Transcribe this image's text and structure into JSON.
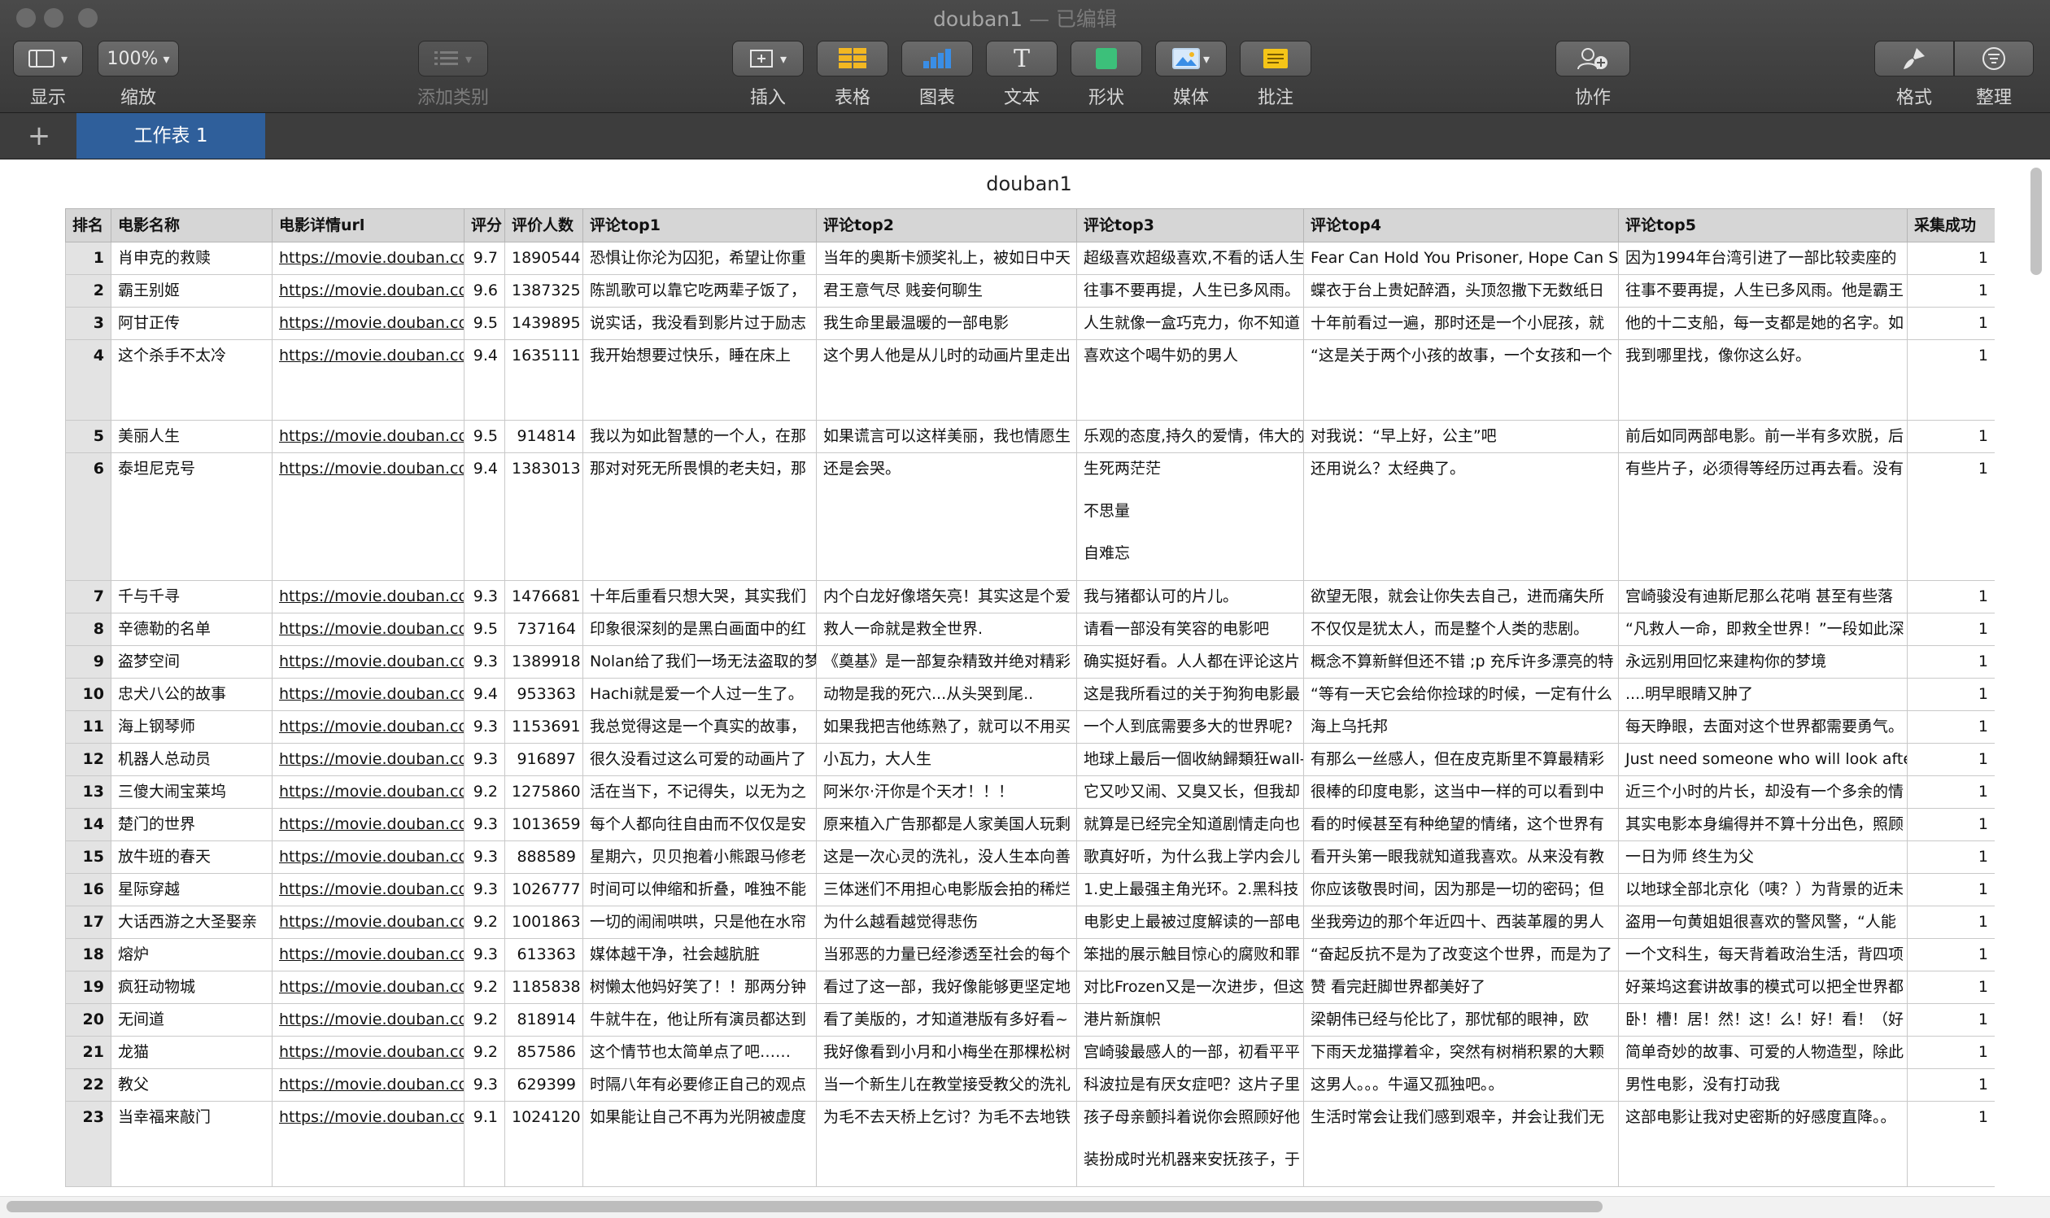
{
  "window": {
    "title": "douban1",
    "title_suffix": "— 已编辑"
  },
  "toolbar": {
    "view_label": "显示",
    "zoom_value": "100%",
    "zoom_label": "缩放",
    "category_label": "添加类别",
    "insert_label": "插入",
    "table_label": "表格",
    "chart_label": "图表",
    "text_label": "文本",
    "text_glyph": "T",
    "shape_label": "形状",
    "media_label": "媒体",
    "comment_label": "批注",
    "collab_label": "协作",
    "format_label": "格式",
    "organize_label": "整理",
    "colors": {
      "table": "#f2b722",
      "chart": "#3a8ee6",
      "shape": "#3cc07a",
      "comment": "#f5c518"
    }
  },
  "sheet_tabs": {
    "add": "+",
    "active": "工作表 1"
  },
  "document": {
    "title": "douban1"
  },
  "table": {
    "headers": [
      "排名",
      "电影名称",
      "电影详情url",
      "评分",
      "评价人数",
      "评论top1",
      "评论top2",
      "评论top3",
      "评论top4",
      "评论top5",
      "采集成功"
    ],
    "rows": [
      {
        "rank": "1",
        "name": "肖申克的救赎",
        "url": "https://movie.douban.com",
        "score": "9.7",
        "count": "1890544",
        "c1": "恐惧让你沦为囚犯，希望让你重",
        "c2": "当年的奥斯卡颁奖礼上，被如日中天",
        "c3": "超级喜欢超级喜欢,不看的话人生",
        "c4": "Fear Can Hold You Prisoner, Hope Can Set",
        "c5": "因为1994年台湾引进了一部比较卖座的",
        "ok": "1"
      },
      {
        "rank": "2",
        "name": "霸王别姬",
        "url": "https://movie.douban.com",
        "score": "9.6",
        "count": "1387325",
        "c1": "陈凯歌可以靠它吃两辈子饭了，",
        "c2": "君王意气尽 贱妾何聊生",
        "c3": "往事不要再提，人生已多风雨。",
        "c4": "蝶衣于台上贵妃醉酒，头顶忽撒下无数纸日",
        "c5": "往事不要再提，人生已多风雨。他是霸王",
        "ok": "1"
      },
      {
        "rank": "3",
        "name": "阿甘正传",
        "url": "https://movie.douban.com",
        "score": "9.5",
        "count": "1439895",
        "c1": "说实话，我没看到影片过于励志",
        "c2": "我生命里最温暖的一部电影",
        "c3": "人生就像一盒巧克力，你不知道",
        "c4": "十年前看过一遍，那时还是一个小屁孩，就",
        "c5": "他的十二支船，每一支都是她的名字。如",
        "ok": "1"
      },
      {
        "rank": "4",
        "name": "这个杀手不太冷",
        "url": "https://movie.douban.com",
        "score": "9.4",
        "count": "1635111",
        "c1": "我开始想要过快乐，睡在床上",
        "c2": "这个男人他是从儿时的动画片里走出",
        "c3": "喜欢这个喝牛奶的男人",
        "c4": "“这是关于两个小孩的故事，一个女孩和一个",
        "c5": "我到哪里找，像你这么好。",
        "ok": "1",
        "tall": 1
      },
      {
        "rank": "5",
        "name": "美丽人生",
        "url": "https://movie.douban.com",
        "score": "9.5",
        "count": "914814",
        "c1": "我以为如此智慧的一个人，在那",
        "c2": "如果谎言可以这样美丽，我也情愿生",
        "c3": "乐观的态度,持久的爱情，伟大的",
        "c4": "对我说：“早上好，公主”吧",
        "c5": "前后如同两部电影。前一半有多欢脱，后",
        "ok": "1"
      },
      {
        "rank": "6",
        "name": "泰坦尼克号",
        "url": "https://movie.douban.com",
        "score": "9.4",
        "count": "1383013",
        "c1": "那对对死无所畏惧的老夫妇，那",
        "c2": "还是会哭。",
        "c3": [
          "生死两茫茫",
          "不思量",
          "自难忘"
        ],
        "c4": "还用说么？太经典了。",
        "c5": "有些片子，必须得等经历过再去看。没有",
        "ok": "1",
        "tall": 2
      },
      {
        "rank": "7",
        "name": "千与千寻",
        "url": "https://movie.douban.com",
        "score": "9.3",
        "count": "1476681",
        "c1": "十年后重看只想大哭，其实我们",
        "c2": "内个白龙好像塔矢亮！其实这是个爱",
        "c3": "我与猪都认可的片儿。",
        "c4": "欲望无限，就会让你失去自己，进而痛失所",
        "c5": "宫崎骏没有迪斯尼那么花哨 甚至有些落",
        "ok": "1"
      },
      {
        "rank": "8",
        "name": "辛德勒的名单",
        "url": "https://movie.douban.com",
        "score": "9.5",
        "count": "737164",
        "c1": "印象很深刻的是黑白画面中的红",
        "c2": "救人一命就是救全世界.",
        "c3": "请看一部没有笑容的电影吧",
        "c4": "不仅仅是犹太人，而是整个人类的悲剧。",
        "c5": "“凡救人一命，即救全世界！”一段如此深",
        "ok": "1"
      },
      {
        "rank": "9",
        "name": "盗梦空间",
        "url": "https://movie.douban.com",
        "score": "9.3",
        "count": "1389918",
        "c1": "Nolan给了我们一场无法盗取的梦",
        "c2": "《奠基》是一部复杂精致并绝对精彩",
        "c3": "确实挺好看。人人都在评论这片",
        "c4": "概念不算新鲜但还不错 ;p 充斥许多漂亮的特",
        "c5": "永远别用回忆来建构你的梦境",
        "ok": "1"
      },
      {
        "rank": "10",
        "name": "忠犬八公的故事",
        "url": "https://movie.douban.com",
        "score": "9.4",
        "count": "953363",
        "c1": "Hachi就是爱一个人过一生了。",
        "c2": "动物是我的死穴...从头哭到尾..",
        "c3": "这是我所看过的关于狗狗电影最",
        "c4": "“等有一天它会给你捡球的时候，一定有什么",
        "c5": "....明早眼睛又肿了",
        "ok": "1"
      },
      {
        "rank": "11",
        "name": "海上钢琴师",
        "url": "https://movie.douban.com",
        "score": "9.3",
        "count": "1153691",
        "c1": "我总觉得这是一个真实的故事，",
        "c2": "如果我把吉他练熟了，就可以不用买",
        "c3": "一个人到底需要多大的世界呢?",
        "c4": "海上乌托邦",
        "c5": "每天睁眼，去面对这个世界都需要勇气。",
        "ok": "1"
      },
      {
        "rank": "12",
        "name": "机器人总动员",
        "url": "https://movie.douban.com",
        "score": "9.3",
        "count": "916897",
        "c1": "很久没看过这么可爱的动画片了",
        "c2": "小瓦力，大人生",
        "c3": "地球上最后一個收納歸類狂wall-e",
        "c4": "有那么一丝感人，但在皮克斯里不算最精彩",
        "c5": "Just need someone who will look after",
        "ok": "1"
      },
      {
        "rank": "13",
        "name": "三傻大闹宝莱坞",
        "url": "https://movie.douban.com",
        "score": "9.2",
        "count": "1275860",
        "c1": "活在当下，不记得失，以无为之",
        "c2": "阿米尔·汗你是个天才！！！",
        "c3": "它又吵又闹、又臭又长，但我却",
        "c4": "很棒的印度电影，这当中一样的可以看到中",
        "c5": "近三个小时的片长，却没有一个多余的情",
        "ok": "1"
      },
      {
        "rank": "14",
        "name": "楚门的世界",
        "url": "https://movie.douban.com",
        "score": "9.3",
        "count": "1013659",
        "c1": "每个人都向往自由而不仅仅是安",
        "c2": "原来植入广告那都是人家美国人玩剩",
        "c3": "就算是已经完全知道剧情走向也",
        "c4": "看的时候甚至有种绝望的情绪，这个世界有",
        "c5": "其实电影本身编得并不算十分出色，照顾",
        "ok": "1"
      },
      {
        "rank": "15",
        "name": "放牛班的春天",
        "url": "https://movie.douban.com",
        "score": "9.3",
        "count": "888589",
        "c1": "星期六，贝贝抱着小熊跟马修老",
        "c2": "这是一次心灵的洗礼，没人生本向善",
        "c3": "歌真好听，为什么我上学内会儿",
        "c4": "看开头第一眼我就知道我喜欢。从来没有教",
        "c5": "一日为师 终生为父",
        "ok": "1"
      },
      {
        "rank": "16",
        "name": "星际穿越",
        "url": "https://movie.douban.com",
        "score": "9.3",
        "count": "1026777",
        "c1": "时间可以伸缩和折叠，唯独不能",
        "c2": "三体迷们不用担心电影版会拍的稀烂",
        "c3": "1.史上最强主角光环。2.黑科技",
        "c4": "你应该敬畏时间，因为那是一切的密码；但",
        "c5": "以地球全部北京化（咦？）为背景的近未",
        "ok": "1"
      },
      {
        "rank": "17",
        "name": "大话西游之大圣娶亲",
        "url": "https://movie.douban.com",
        "score": "9.2",
        "count": "1001863",
        "c1": "一切的闹闹哄哄，只是他在水帘",
        "c2": "为什么越看越觉得悲伤",
        "c3": "电影史上最被过度解读的一部电",
        "c4": "坐我旁边的那个年近四十、西装革履的男人",
        "c5": "盗用一句黄姐姐很喜欢的警风警，“人能",
        "ok": "1"
      },
      {
        "rank": "18",
        "name": "熔炉",
        "url": "https://movie.douban.com",
        "score": "9.3",
        "count": "613363",
        "c1": "媒体越干净，社会越肮脏",
        "c2": "当邪恶的力量已经渗透至社会的每个",
        "c3": "笨拙的展示触目惊心的腐败和罪",
        "c4": "“奋起反抗不是为了改变这个世界，而是为了",
        "c5": "一个文科生，每天背着政治生活，背四项",
        "ok": "1"
      },
      {
        "rank": "19",
        "name": "疯狂动物城",
        "url": "https://movie.douban.com",
        "score": "9.2",
        "count": "1185838",
        "c1": "树懒太他妈好笑了！！那两分钟",
        "c2": "看过了这一部，我好像能够更坚定地",
        "c3": "对比Frozen又是一次进步，但这",
        "c4": "赞 看完赶脚世界都美好了",
        "c5": "好莱坞这套讲故事的模式可以把全世界都",
        "ok": "1"
      },
      {
        "rank": "20",
        "name": "无间道",
        "url": "https://movie.douban.com",
        "score": "9.2",
        "count": "818914",
        "c1": "牛就牛在，他让所有演员都达到",
        "c2": "看了美版的，才知道港版有多好看~",
        "c3": "港片新旗帜",
        "c4": "梁朝伟已经与伦比了，那忧郁的眼神，欧",
        "c5": "卧！槽！居！然！这！么！好！看！（好",
        "ok": "1"
      },
      {
        "rank": "21",
        "name": "龙猫",
        "url": "https://movie.douban.com",
        "score": "9.2",
        "count": "857586",
        "c1": "这个情节也太简单点了吧……",
        "c2": "我好像看到小月和小梅坐在那棵松树",
        "c3": "宫崎骏最感人的一部，初看平平",
        "c4": "下雨天龙猫撑着伞，突然有树梢积累的大颗",
        "c5": "简单奇妙的故事、可爱的人物造型，除此",
        "ok": "1"
      },
      {
        "rank": "22",
        "name": "教父",
        "url": "https://movie.douban.com",
        "score": "9.3",
        "count": "629399",
        "c1": "时隔八年有必要修正自己的观点",
        "c2": "当一个新生儿在教堂接受教父的洗礼",
        "c3": "科波拉是有厌女症吧？这片子里",
        "c4": "这男人。。。牛逼又孤独吧。。",
        "c5": "男性电影，没有打动我",
        "ok": "1"
      },
      {
        "rank": "23",
        "name": "当幸福来敲门",
        "url": "https://movie.douban.com",
        "score": "9.1",
        "count": "1024120",
        "c1": "如果能让自己不再为光阴被虚度",
        "c2": "为毛不去天桥上乞讨？为毛不去地铁",
        "c3": [
          "孩子母亲颤抖着说你会照顾好他",
          "装扮成时光机器来安抚孩子，于"
        ],
        "c4": "生活时常会让我们感到艰辛，并会让我们无",
        "c5": "这部电影让我对史密斯的好感度直降。。",
        "ok": "1",
        "tall": 1
      }
    ]
  }
}
